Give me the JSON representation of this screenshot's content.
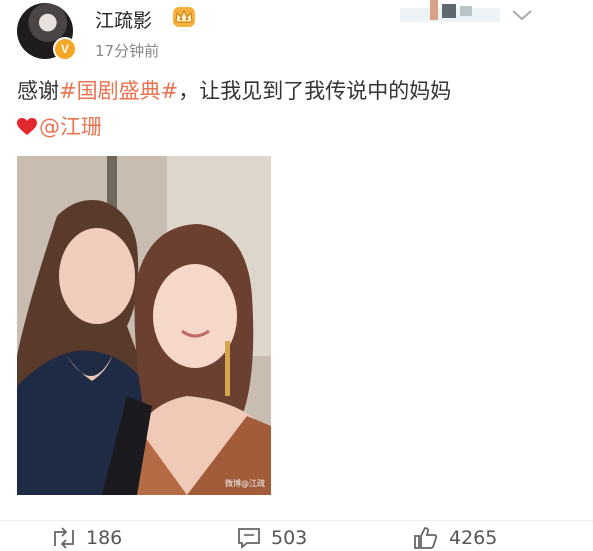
{
  "author": {
    "name": "江疏影",
    "verified_badge": "V",
    "time": "17分钟前"
  },
  "post": {
    "text_prefix": "感谢",
    "hashtag": "#国剧盛典#",
    "text_suffix": "，让我见到了我传说中的妈妈",
    "mention": "@江珊",
    "heart_icon": "red-heart-icon"
  },
  "image": {
    "watermark": "微博@江疏"
  },
  "actions": {
    "repost_count": "186",
    "comment_count": "503",
    "like_count": "4265"
  },
  "colors": {
    "accent": "#eb7350",
    "badge": "#f5a623",
    "text": "#333333",
    "muted": "#888888"
  }
}
